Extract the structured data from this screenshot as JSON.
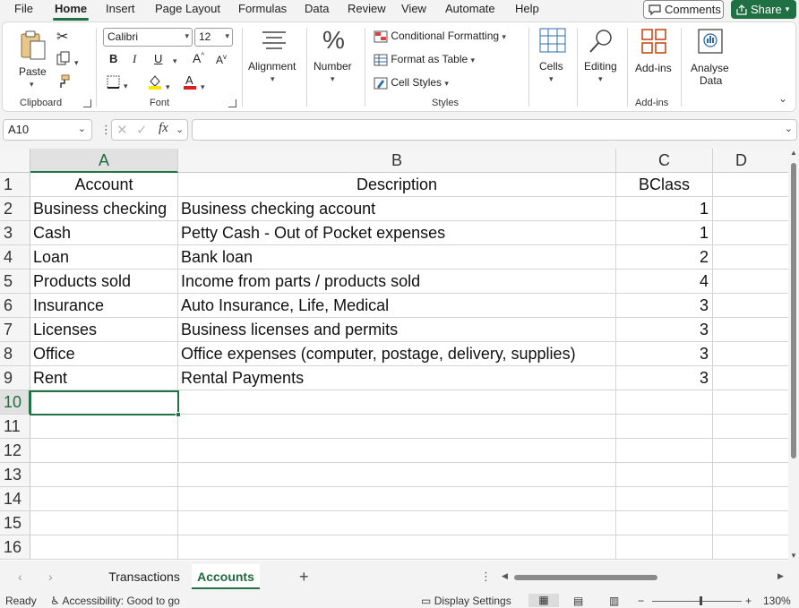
{
  "menu": {
    "items": [
      "File",
      "Home",
      "Insert",
      "Page Layout",
      "Formulas",
      "Data",
      "Review",
      "View",
      "Automate",
      "Help"
    ],
    "active": "Home",
    "comments_label": "Comments",
    "share_label": "Share"
  },
  "ribbon": {
    "clipboard": {
      "paste_label": "Paste",
      "group_label": "Clipboard"
    },
    "font": {
      "font_name": "Calibri",
      "font_size": "12",
      "group_label": "Font",
      "bold": "B",
      "italic": "I",
      "underline": "U"
    },
    "alignment": {
      "label": "Alignment"
    },
    "number": {
      "label": "Number",
      "icon_glyph": "%"
    },
    "styles": {
      "conditional_formatting": "Conditional Formatting",
      "format_as_table": "Format as Table",
      "cell_styles": "Cell Styles",
      "group_label": "Styles"
    },
    "cells": {
      "label": "Cells"
    },
    "editing": {
      "label": "Editing"
    },
    "addins": {
      "label": "Add-ins",
      "group_label": "Add-ins"
    },
    "analyse": {
      "label_line1": "Analyse",
      "label_line2": "Data"
    }
  },
  "formula_bar": {
    "name_box": "A10",
    "formula": "",
    "fx_label": "fx"
  },
  "sheet": {
    "columns": [
      "A",
      "B",
      "C",
      "D"
    ],
    "selected_column": "A",
    "row_numbers": [
      "1",
      "2",
      "3",
      "4",
      "5",
      "6",
      "7",
      "8",
      "9",
      "10",
      "11",
      "12",
      "13",
      "14",
      "15",
      "16"
    ],
    "selected_row": "10",
    "header_row": {
      "a": "Account",
      "b": "Description",
      "c": "BClass"
    },
    "rows": [
      {
        "a": "Business checking",
        "b": "Business checking account",
        "c": "1"
      },
      {
        "a": "Cash",
        "b": "Petty Cash - Out of Pocket expenses",
        "c": "1"
      },
      {
        "a": "Loan",
        "b": "Bank loan",
        "c": "2"
      },
      {
        "a": "Products sold",
        "b": "Income from parts / products sold",
        "c": "4"
      },
      {
        "a": "Insurance",
        "b": "Auto Insurance, Life, Medical",
        "c": "3"
      },
      {
        "a": "Licenses",
        "b": "Business licenses and permits",
        "c": "3"
      },
      {
        "a": "Office",
        "b": "Office expenses (computer, postage, delivery, supplies)",
        "c": "3"
      },
      {
        "a": "Rent",
        "b": "Rental Payments",
        "c": "3"
      }
    ]
  },
  "sheet_tabs": {
    "tabs": [
      "Transactions",
      "Accounts"
    ],
    "active": "Accounts"
  },
  "status_bar": {
    "ready": "Ready",
    "accessibility": "Accessibility: Good to go",
    "display_settings": "Display Settings",
    "zoom": "130%"
  },
  "colors": {
    "accent": "#217346",
    "share_bg": "#1f7144"
  }
}
